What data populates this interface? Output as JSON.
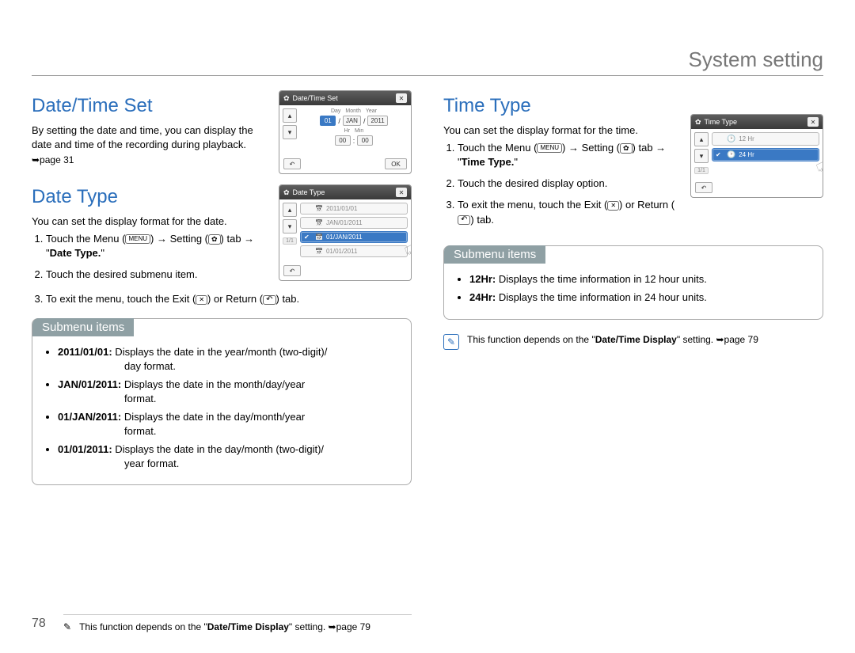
{
  "header": {
    "title": "System setting"
  },
  "page_number": "78",
  "left": {
    "sec1_title": "Date/Time Set",
    "sec1_body": "By setting the date and time, you can display the date and time of the recording during playback.",
    "sec1_pageref": "➥page 31",
    "sec2_title": "Date Type",
    "sec2_body": "You can set the display format for the date.",
    "steps": {
      "s1a": "Touch the Menu (",
      "s1b": ") ",
      "s1c": " Setting (",
      "s1d": ") tab ",
      "s1e": " \"",
      "s1_bold": "Date Type.",
      "s1f": "\"",
      "s2": "Touch the desired submenu item.",
      "s3a": "To exit the menu, touch the Exit (",
      "s3b": ") or Return (",
      "s3c": ") tab."
    },
    "submenu_label": "Submenu items",
    "submenu": [
      {
        "b": "2011/01/01:",
        "t1": " Displays the date in the year/month (two-digit)/",
        "t2": "day format."
      },
      {
        "b": "JAN/01/2011:",
        "t1": " Displays the date in the month/day/year",
        "t2": "format."
      },
      {
        "b": "01/JAN/2011:",
        "t1": " Displays the date in the day/month/year",
        "t2": "format."
      },
      {
        "b": "01/01/2011:",
        "t1": " Displays the date in the day/month (two-digit)/",
        "t2": "year format."
      }
    ],
    "note_a": "This function depends on the \"",
    "note_bold": "Date/Time Display",
    "note_b": "\" setting. ➥page 79"
  },
  "right": {
    "sec_title": "Time Type",
    "sec_body": "You can set the display format for the time.",
    "steps": {
      "s1a": "Touch the Menu (",
      "s1b": ") ",
      "s1c": " Setting (",
      "s1d": ") tab ",
      "s1e": " \"",
      "s1_bold": "Time Type.",
      "s1f": "\"",
      "s2": "Touch the desired display option.",
      "s3a": "To exit the menu, touch the Exit (",
      "s3b": ") or Return (",
      "s3c": ") tab."
    },
    "submenu_label": "Submenu items",
    "submenu": [
      {
        "b": "12Hr:",
        "t": " Displays the time information in 12 hour units."
      },
      {
        "b": "24Hr:",
        "t": " Displays the time information in 24 hour units."
      }
    ],
    "note_a": "This function depends on the \"",
    "note_bold": "Date/Time Display",
    "note_b": "\" setting. ➥page 79"
  },
  "shots": {
    "dts": {
      "title": "Date/Time Set",
      "hdr": [
        "Day",
        "Month",
        "Year"
      ],
      "row1": [
        "01",
        "JAN",
        "2011"
      ],
      "hdr2": [
        "Hr",
        "Min"
      ],
      "row2": [
        "00",
        "00"
      ],
      "ok": "OK"
    },
    "dtype": {
      "title": "Date Type",
      "opts": [
        "2011/01/01",
        "JAN/01/2011",
        "01/JAN/2011",
        "01/01/2011"
      ],
      "sel_index": 2,
      "page": "1/1"
    },
    "ttype": {
      "title": "Time Type",
      "opts": [
        "12 Hr",
        "24 Hr"
      ],
      "sel_index": 1,
      "page": "1/1"
    }
  }
}
